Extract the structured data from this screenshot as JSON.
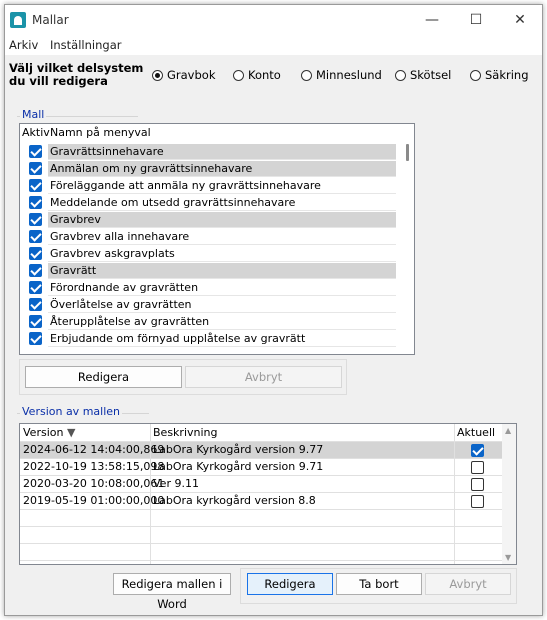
{
  "window": {
    "title": "Mallar"
  },
  "window_controls": {
    "minimize": "—",
    "maximize": "☐",
    "close": "✕"
  },
  "menu": {
    "items": [
      "Arkiv",
      "Inställningar"
    ]
  },
  "subsystem": {
    "prompt": "Välj vilket delsystem du vill redigera",
    "options": [
      {
        "label": "Gravbok",
        "checked": true
      },
      {
        "label": "Konto",
        "checked": false
      },
      {
        "label": "Minneslund",
        "checked": false
      },
      {
        "label": "Skötsel",
        "checked": false
      },
      {
        "label": "Säkring",
        "checked": false
      }
    ]
  },
  "mall_group": {
    "label": "Mall",
    "columns": {
      "active": "Aktiv",
      "name": "Namn på menyval"
    },
    "rows": [
      {
        "label": "Gravrättsinnehavare",
        "active": true,
        "highlight": true
      },
      {
        "label": "Anmälan om ny gravrättsinnehavare",
        "active": true,
        "highlight": true
      },
      {
        "label": "Föreläggande att anmäla ny gravrättsinnehavare",
        "active": true,
        "highlight": false
      },
      {
        "label": "Meddelande om utsedd gravrättsinnehavare",
        "active": true,
        "highlight": false
      },
      {
        "label": "Gravbrev",
        "active": true,
        "highlight": true
      },
      {
        "label": "Gravbrev alla innehavare",
        "active": true,
        "highlight": false
      },
      {
        "label": "Gravbrev askgravplats",
        "active": true,
        "highlight": false
      },
      {
        "label": "Gravrätt",
        "active": true,
        "highlight": true
      },
      {
        "label": "Förordnande av gravrätten",
        "active": true,
        "highlight": false
      },
      {
        "label": "Överlåtelse av gravrätten",
        "active": true,
        "highlight": false
      },
      {
        "label": "Återupplåtelse av gravrätten",
        "active": true,
        "highlight": false
      },
      {
        "label": "Erbjudande om förnyad upplåtelse av gravrätt",
        "active": true,
        "highlight": false
      }
    ],
    "buttons": {
      "edit": "Redigera",
      "cancel": "Avbryt"
    }
  },
  "version_group": {
    "label": "Version av mallen",
    "columns": {
      "version": "Version",
      "description": "Beskrivning",
      "current": "Aktuell"
    },
    "rows": [
      {
        "version": "2024-06-12 14:04:00,869",
        "description": "LabOra Kyrkogård version 9.77",
        "current": true,
        "selected": true
      },
      {
        "version": "2022-10-19 13:58:15,098",
        "description": "LabOra Kyrkogård version 9.71",
        "current": false,
        "selected": false
      },
      {
        "version": "2020-03-20 10:08:00,061",
        "description": "Ver 9.11",
        "current": false,
        "selected": false
      },
      {
        "version": "2019-05-19 01:00:00,000",
        "description": "LabOra kyrkogård version 8.8",
        "current": false,
        "selected": false
      }
    ]
  },
  "bottom_buttons": {
    "edit_in_word": "Redigera mallen i Word",
    "edit": "Redigera",
    "delete": "Ta bort",
    "cancel": "Avbryt"
  },
  "colors": {
    "accent": "#0a64c8",
    "highlight_row": "#d4d4d4",
    "group_label": "#0a2fa8"
  }
}
